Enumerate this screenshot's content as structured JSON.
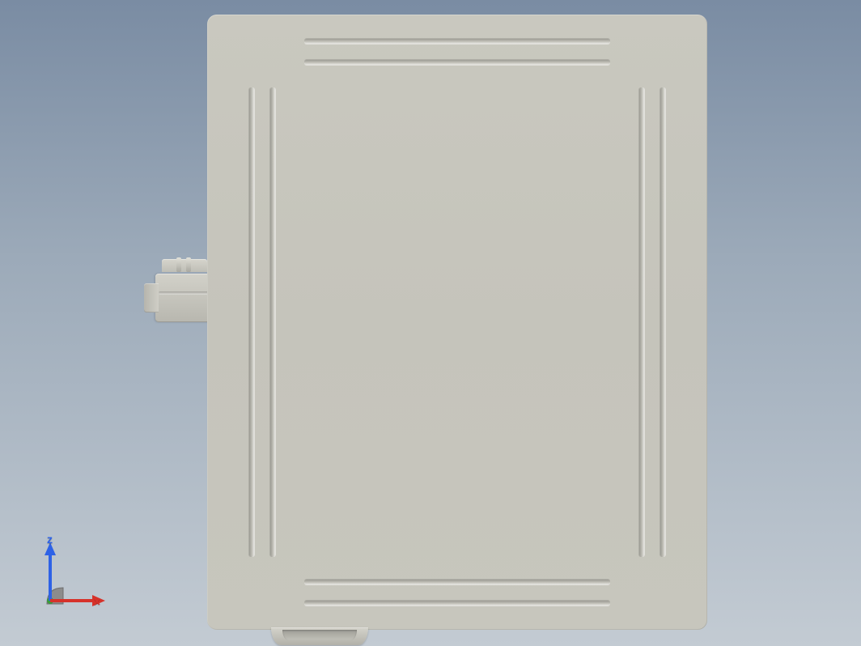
{
  "axes": {
    "z": {
      "label": "z",
      "color": "#2e62e6"
    },
    "x": {
      "label": "x",
      "color": "#d6322a"
    },
    "y": {
      "color": "#3a9b3a"
    }
  },
  "model": {
    "panel_color": "#c7c6bd",
    "slots": {
      "top_outer": true,
      "top_inner": true,
      "left_outer": true,
      "left_inner": true,
      "right_outer": true,
      "right_inner": true,
      "bottom_outer": true,
      "bottom_inner": true
    },
    "side_connector": true,
    "bottom_connector": true
  }
}
